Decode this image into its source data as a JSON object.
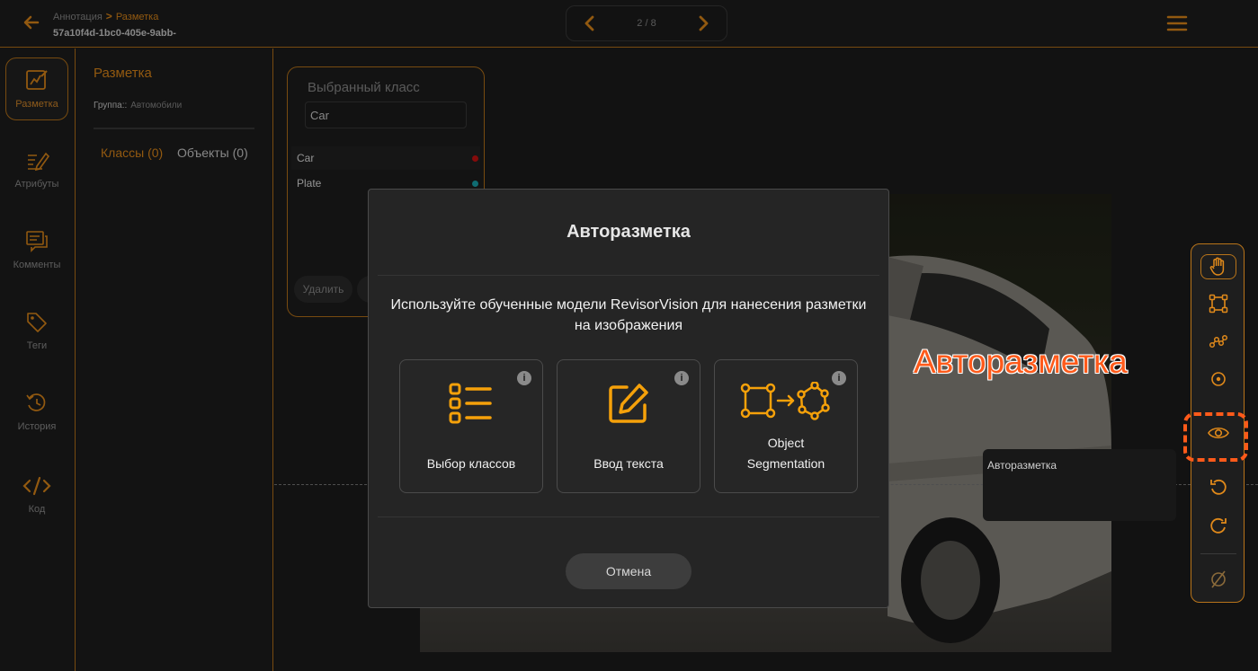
{
  "header": {
    "breadcrumb_parent": "Аннотация",
    "breadcrumb_separator": ">",
    "breadcrumb_current": "Разметка",
    "document_id": "57a10f4d-1bc0-405e-9abb-",
    "page_counter": "2 / 8"
  },
  "sidebar": {
    "items": [
      {
        "label": "Разметка",
        "icon": "markup-icon",
        "active": true
      },
      {
        "label": "Атрибуты",
        "icon": "attributes-icon"
      },
      {
        "label": "Комменты",
        "icon": "comments-icon"
      },
      {
        "label": "Теги",
        "icon": "tags-icon"
      },
      {
        "label": "История",
        "icon": "history-icon"
      },
      {
        "label": "Код",
        "icon": "code-icon"
      }
    ]
  },
  "panel": {
    "title": "Разметка",
    "group_label": "Группа::",
    "group_value": "Автомобили",
    "tabs": [
      {
        "label": "Классы (0)",
        "active": true
      },
      {
        "label": "Объекты (0)"
      }
    ]
  },
  "class_selector": {
    "title": "Выбранный класс",
    "value": "Car",
    "classes": [
      {
        "name": "Car",
        "color": "#cc1111"
      },
      {
        "name": "Plate",
        "color": "#17a6b0"
      }
    ],
    "delete_label": "Удалить"
  },
  "toolbar": {
    "tools": [
      "hand-icon",
      "bbox-icon",
      "polygon-icon",
      "point-icon",
      "eye-icon",
      "undo-icon",
      "redo-icon",
      "clear-icon"
    ],
    "tooltip": "Авторазметка",
    "callout": "Авторазметка"
  },
  "modal": {
    "title": "Авторазметка",
    "description": "Используйте обученные модели RevisorVision для нанесения разметки на изображения",
    "options": [
      {
        "label": "Выбор классов",
        "icon": "class-list-icon",
        "info": "i"
      },
      {
        "label": "Ввод текста",
        "icon": "text-edit-icon",
        "info": "i"
      },
      {
        "label_line1": "Object",
        "label_line2": "Segmentation",
        "icon": "object-segmentation-icon",
        "info": "i"
      }
    ],
    "cancel_label": "Отмена"
  },
  "colors": {
    "accent": "#e0891a",
    "border_accent": "#b8741a",
    "callout": "#ff5a1a",
    "background": "#1c1c1c"
  }
}
